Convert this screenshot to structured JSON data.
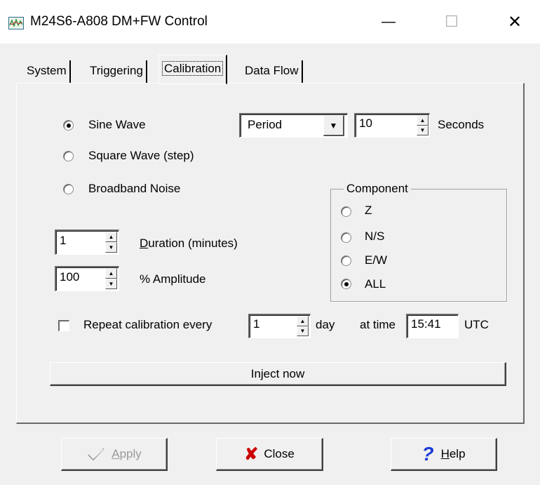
{
  "window": {
    "title": "M24S6-A808 DM+FW Control",
    "minimize_glyph": "—",
    "maximize_glyph": "☐",
    "close_glyph": "✕"
  },
  "tabs": [
    {
      "label": "System"
    },
    {
      "label": "Triggering"
    },
    {
      "label": "Calibration",
      "active": true
    },
    {
      "label": "Data Flow"
    }
  ],
  "calibration": {
    "waveforms": [
      {
        "label": "Sine Wave",
        "selected": true
      },
      {
        "label": "Square Wave (step)",
        "selected": false
      },
      {
        "label": "Broadband Noise",
        "selected": false
      }
    ],
    "period_mode": {
      "value": "Period"
    },
    "period_value": "10",
    "period_unit": "Seconds",
    "component": {
      "title": "Component",
      "options": [
        {
          "label": "Z",
          "selected": false
        },
        {
          "label": "N/S",
          "selected": false
        },
        {
          "label": "E/W",
          "selected": false
        },
        {
          "label": "ALL",
          "selected": true
        }
      ]
    },
    "duration": {
      "value": "1",
      "label_first": "D",
      "label_rest": "uration (minutes)"
    },
    "amplitude": {
      "value": "100",
      "label": "% Amplitude"
    },
    "repeat": {
      "checked": false,
      "label": "Repeat calibration every",
      "every_value": "1",
      "unit": "day",
      "at_time_label": "at time",
      "time_value": "15:41",
      "tz": "UTC"
    },
    "inject_label": "Inject now"
  },
  "footer": {
    "apply": {
      "first": "A",
      "rest": "pply",
      "icon": "check-icon",
      "disabled": true
    },
    "close": {
      "label": "Close",
      "icon": "x-icon",
      "color": "#000000"
    },
    "help": {
      "first": "H",
      "rest": "elp",
      "icon": "question-icon",
      "color": "#1c3bd6"
    }
  }
}
